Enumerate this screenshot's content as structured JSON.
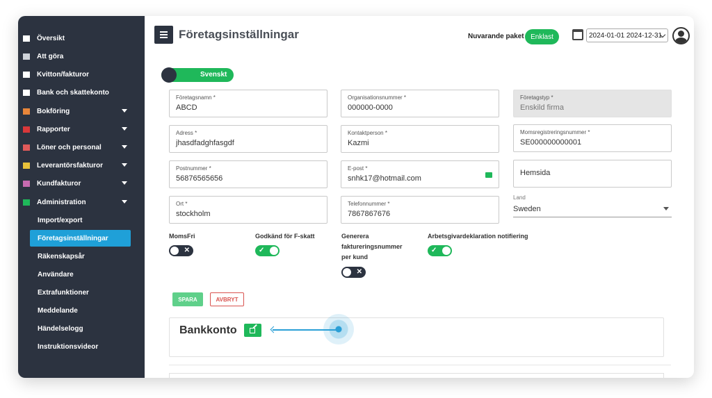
{
  "sidebar": {
    "items": [
      {
        "label": "Översikt",
        "icon": "home-icon",
        "color": "#ffffff"
      },
      {
        "label": "Att göra",
        "icon": "list-icon",
        "color": "#cfd3da"
      },
      {
        "label": "Kvitton/fakturor",
        "icon": "receipt-icon",
        "color": "#ffffff"
      },
      {
        "label": "Bank och skattekonto",
        "icon": "bank-icon",
        "color": "#ffffff"
      },
      {
        "label": "Bokföring",
        "icon": "book-icon",
        "color": "#e8863a"
      },
      {
        "label": "Rapporter",
        "icon": "report-icon",
        "color": "#d9383a"
      },
      {
        "label": "Löner och personal",
        "icon": "salary-icon",
        "color": "#e05a5a"
      },
      {
        "label": "Leverantörsfakturor",
        "icon": "supplier-invoice-icon",
        "color": "#e8c23a"
      },
      {
        "label": "Kundfakturor",
        "icon": "customer-invoice-icon",
        "color": "#c76bb0"
      },
      {
        "label": "Administration",
        "icon": "admin-icon",
        "color": "#1fb85a"
      }
    ],
    "sub_items": [
      {
        "label": "Import/export"
      },
      {
        "label": "Företagsinställningar"
      },
      {
        "label": "Räkenskapsår"
      },
      {
        "label": "Användare"
      },
      {
        "label": "Extrafunktioner"
      },
      {
        "label": "Meddelande"
      },
      {
        "label": "Händelselogg"
      },
      {
        "label": "Instruktionsvideor"
      }
    ]
  },
  "header": {
    "title": "Företagsinställningar",
    "package_label": "Nuvarande paket",
    "package_badge": "Enklast",
    "period": "2024-01-01 2024-12-31"
  },
  "language_toggle": "Svenskt",
  "form": {
    "company_name": {
      "label": "Företagsnamn *",
      "value": "ABCD"
    },
    "org_number": {
      "label": "Organisationsnummer *",
      "value": "000000-0000"
    },
    "company_type": {
      "label": "Företagstyp *",
      "value": "Enskild firma"
    },
    "address": {
      "label": "Adress *",
      "value": "jhasdfadghfasgdf"
    },
    "contact": {
      "label": "Kontaktperson *",
      "value": "Kazmi"
    },
    "vat_number": {
      "label": "Momsregistreringsnummer *",
      "value": "SE000000000001"
    },
    "postcode": {
      "label": "Postnummer *",
      "value": "56876565656"
    },
    "email": {
      "label": "E-post *",
      "value": "snhk17@hotmail.com"
    },
    "website": {
      "placeholder": "Hemsida"
    },
    "city": {
      "label": "Ort *",
      "value": "stockholm"
    },
    "phone": {
      "label": "Telefonnummer *",
      "value": "7867867676"
    },
    "country": {
      "label": "Land",
      "value": "Sweden"
    }
  },
  "switches": {
    "momsfri": {
      "label": "MomsFri",
      "on": false
    },
    "fskatt": {
      "label": "Godkänd för F-skatt",
      "on": true
    },
    "invoice_number": {
      "label_lines": [
        "Generera",
        "faktureringsnummer",
        "per kund"
      ],
      "on": false
    },
    "employer_declaration": {
      "label": "Arbetsgivardeklaration notifiering",
      "on": true
    }
  },
  "buttons": {
    "save": "SPARA",
    "cancel": "AVBRYT"
  },
  "bank": {
    "title": "Bankkonto"
  }
}
